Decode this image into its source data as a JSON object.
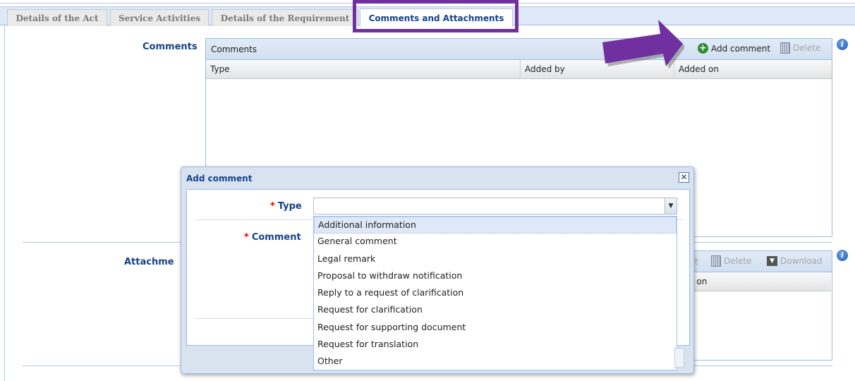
{
  "tabs": [
    {
      "label": "Details of the Act"
    },
    {
      "label": "Service Activities"
    },
    {
      "label": "Details of the Requirement"
    },
    {
      "label": "Comments and Attachments"
    }
  ],
  "comments": {
    "section_label": "Comments",
    "grid_title": "Comments",
    "add_label": "Add comment",
    "delete_label": "Delete",
    "columns": [
      "Type",
      "Added by",
      "Added on"
    ]
  },
  "attachments": {
    "section_label": "Attachme",
    "edit_label": "dit",
    "delete_label": "Delete",
    "download_label": "Download",
    "column_partial": "ded on"
  },
  "dialog": {
    "title": "Add comment",
    "close_glyph": "✕",
    "type_label": "Type",
    "comment_label": "Comment",
    "required_mark": "*",
    "type_value": "",
    "type_options": [
      "Additional information",
      "General comment",
      "Legal remark",
      "Proposal to withdraw notification",
      "Reply to a request of clarification",
      "Request for clarification",
      "Request for supporting document",
      "Request for translation",
      "Other"
    ],
    "highlighted_option": "Additional information"
  },
  "icons": {
    "add": "plus-circle-icon",
    "delete": "trash-icon",
    "download": "download-icon",
    "info": "info-icon",
    "combo": "chevron-down-icon"
  },
  "colors": {
    "accent": "#15428b",
    "highlight_annotation": "#7030a0",
    "panel_border": "#99bbe8"
  }
}
